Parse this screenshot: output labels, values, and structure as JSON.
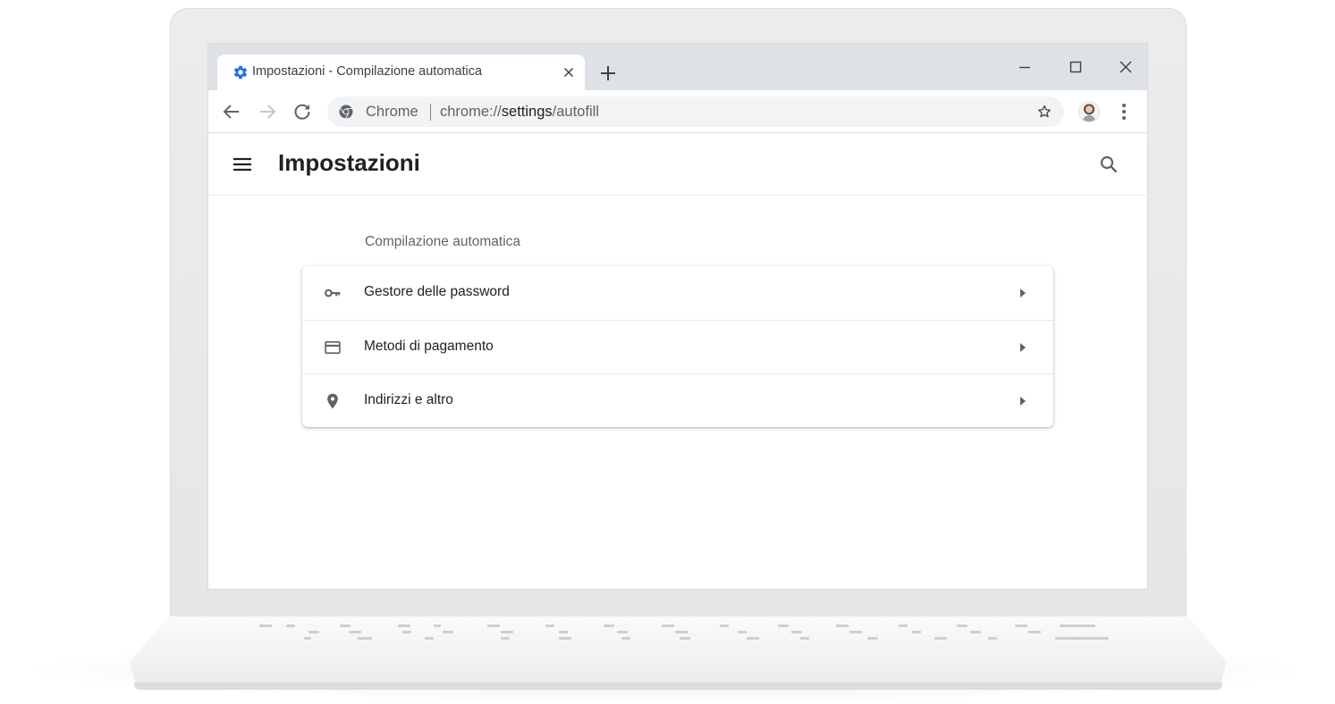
{
  "browser": {
    "tab": {
      "title": "Impostazioni - Compilazione automatica",
      "favicon": "settings-gear-icon",
      "favicon_color": "#1a73e8"
    },
    "window_controls": [
      "minimize-icon",
      "maximize-icon",
      "close-icon"
    ],
    "toolbar": {
      "back": "arrow-back-icon",
      "forward": "arrow-forward-icon",
      "reload": "reload-icon",
      "omnibox": {
        "site_icon": "chrome-logo-icon",
        "chip": "Chrome",
        "url_scheme": "chrome://",
        "url_host": "settings",
        "url_path": "/autofill",
        "bookmark": "star-outline-icon"
      },
      "profile": "avatar",
      "menu": "more-vert-icon"
    }
  },
  "settings": {
    "header": {
      "menu": "hamburger-menu-icon",
      "title": "Impostazioni",
      "search": "search-icon"
    },
    "section": {
      "title": "Compilazione automatica",
      "items": [
        {
          "label": "Gestore delle password",
          "icon": "key-icon"
        },
        {
          "label": "Metodi di pagamento",
          "icon": "credit-card-icon"
        },
        {
          "label": "Indirizzi e altro",
          "icon": "location-pin-icon"
        }
      ]
    }
  },
  "colors": {
    "accent": "#1a73e8",
    "tabstrip": "#dee1e6",
    "omnibox": "#f1f3f4",
    "icon": "#5f6368",
    "text": "#202124"
  }
}
